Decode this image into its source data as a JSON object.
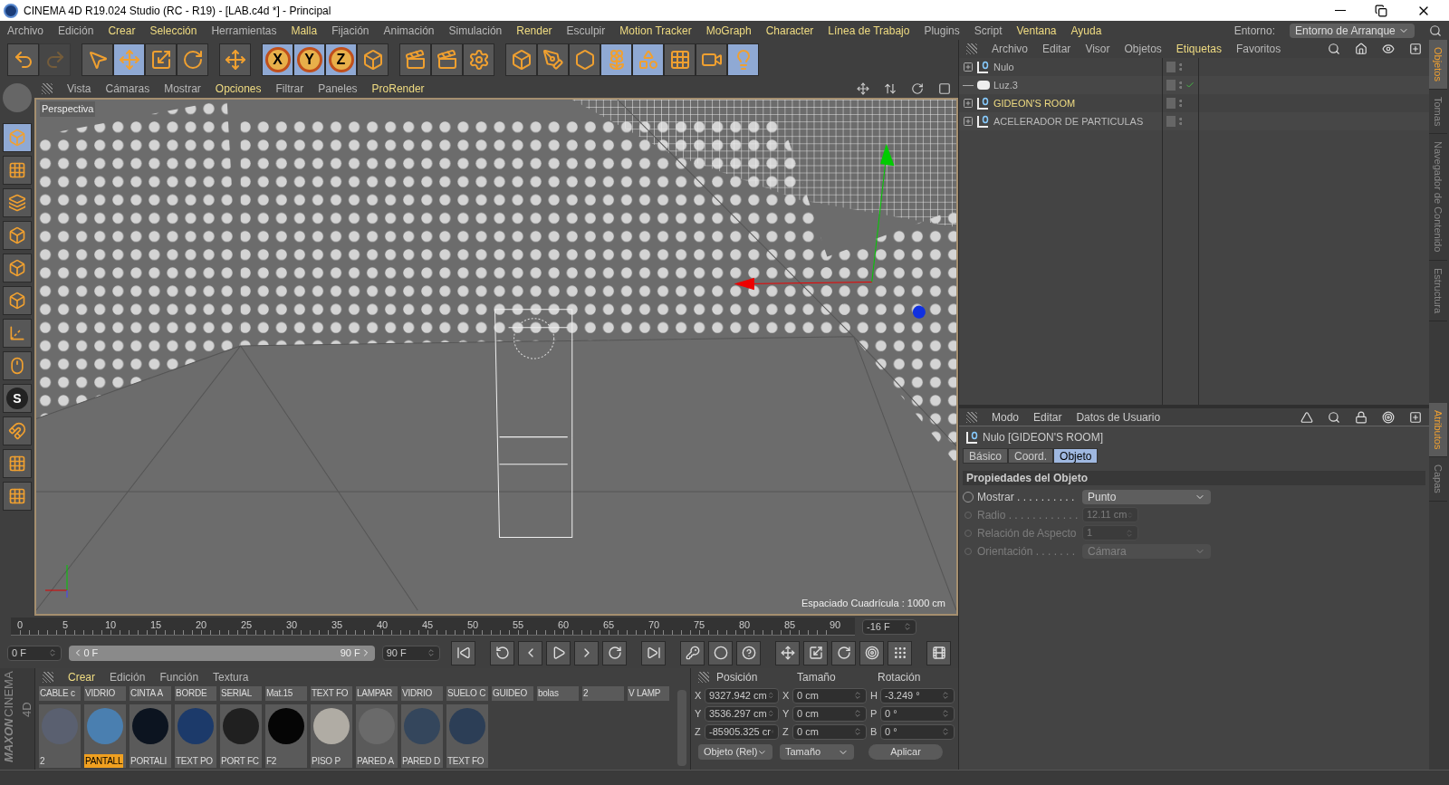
{
  "window": {
    "title": "CINEMA 4D R19.024 Studio (RC - R19) - [LAB.c4d *] - Principal"
  },
  "menu": [
    {
      "label": "Archivo",
      "highlighted": false
    },
    {
      "label": "Edición",
      "highlighted": false
    },
    {
      "label": "Crear",
      "highlighted": true
    },
    {
      "label": "Selección",
      "highlighted": true
    },
    {
      "label": "Herramientas",
      "highlighted": false
    },
    {
      "label": "Malla",
      "highlighted": true
    },
    {
      "label": "Fijación",
      "highlighted": false
    },
    {
      "label": "Animación",
      "highlighted": false
    },
    {
      "label": "Simulación",
      "highlighted": false
    },
    {
      "label": "Render",
      "highlighted": true
    },
    {
      "label": "Esculpir",
      "highlighted": false
    },
    {
      "label": "Motion Tracker",
      "highlighted": true
    },
    {
      "label": "MoGraph",
      "highlighted": true
    },
    {
      "label": "Character",
      "highlighted": true
    },
    {
      "label": "Línea de Trabajo",
      "highlighted": true
    },
    {
      "label": "Plugins",
      "highlighted": false
    },
    {
      "label": "Script",
      "highlighted": false
    },
    {
      "label": "Ventana",
      "highlighted": true
    },
    {
      "label": "Ayuda",
      "highlighted": true
    }
  ],
  "layout": {
    "label": "Entorno:",
    "value": "Entorno de Arranque"
  },
  "toolbar": [
    {
      "selected": false,
      "disabled": false
    },
    {
      "selected": false,
      "disabled": true
    },
    {
      "selected": false,
      "disabled": false
    },
    {
      "selected": true,
      "disabled": false
    },
    {
      "selected": false,
      "disabled": false
    },
    {
      "selected": false,
      "disabled": false
    },
    {
      "selected": false,
      "disabled": false
    },
    {
      "label": "X",
      "selected": true,
      "disabled": false
    },
    {
      "label": "Y",
      "selected": true,
      "disabled": false
    },
    {
      "label": "Z",
      "selected": true,
      "disabled": false
    },
    {
      "selected": false,
      "disabled": false
    },
    {
      "selected": false,
      "disabled": false
    },
    {
      "selected": false,
      "disabled": false
    },
    {
      "selected": false,
      "disabled": false
    },
    {
      "selected": false,
      "disabled": false
    },
    {
      "selected": false,
      "disabled": false
    },
    {
      "selected": false,
      "disabled": false
    },
    {
      "selected": true,
      "disabled": false
    },
    {
      "selected": true,
      "disabled": false
    },
    {
      "selected": false,
      "disabled": false
    },
    {
      "selected": false,
      "disabled": false
    },
    {
      "selected": true,
      "disabled": false
    }
  ],
  "left_tools": [
    {
      "selected": true
    },
    {
      "selected": false
    },
    {
      "selected": false
    },
    {
      "selected": false
    },
    {
      "selected": false
    },
    {
      "selected": false
    },
    {
      "selected": false
    },
    {
      "selected": false
    },
    {
      "label": "S",
      "selected": false
    },
    {
      "selected": false
    },
    {
      "selected": false
    },
    {
      "selected": false
    }
  ],
  "viewport": {
    "menu": [
      {
        "label": "Vista",
        "highlighted": false
      },
      {
        "label": "Cámaras",
        "highlighted": false
      },
      {
        "label": "Mostrar",
        "highlighted": false
      },
      {
        "label": "Opciones",
        "highlighted": true
      },
      {
        "label": "Filtrar",
        "highlighted": false
      },
      {
        "label": "Paneles",
        "highlighted": false
      },
      {
        "label": "ProRender",
        "highlighted": true
      }
    ],
    "camera": "Perspectiva",
    "grid_spacing": "Espaciado Cuadrícula : 1000 cm"
  },
  "timeline": {
    "ticks": [
      "0",
      "5",
      "10",
      "15",
      "20",
      "25",
      "30",
      "35",
      "40",
      "45",
      "50",
      "55",
      "60",
      "65",
      "70",
      "75",
      "80",
      "85",
      "90"
    ],
    "current_frame": "-16 F",
    "start": "0 F",
    "range_slider": {
      "level": 1
    },
    "range_start": "0 F",
    "range_end": "90 F",
    "end": "90 F"
  },
  "materials": {
    "menu": [
      {
        "label": "Crear",
        "highlighted": true
      },
      {
        "label": "Edición",
        "highlighted": false
      },
      {
        "label": "Función",
        "highlighted": false
      },
      {
        "label": "Textura",
        "highlighted": false
      }
    ],
    "top_row": [
      "CABLE c",
      "VIDRIO",
      "CINTA A",
      "BORDE",
      "SERIAL",
      "Mat.15",
      "TEXT FO",
      "LAMPAR",
      "VIDRIO",
      "SUELO C",
      "GUIDEO",
      "bolas",
      "2",
      "V LAMP"
    ],
    "items": [
      {
        "name": "2",
        "color": "#5a6070",
        "selected": false
      },
      {
        "name": "PANTALL",
        "color": "#4a7fb0",
        "selected": true
      },
      {
        "name": "PORTALI",
        "color": "#0c1420",
        "selected": false
      },
      {
        "name": "TEXT PO",
        "color": "#1c3a6a",
        "selected": false
      },
      {
        "name": "PORT FC",
        "color": "#202020",
        "selected": false
      },
      {
        "name": "F2",
        "color": "#050505",
        "selected": false
      },
      {
        "name": "PISO P",
        "color": "#b0aca4",
        "selected": false
      },
      {
        "name": "PARED A",
        "color": "#6a6a6a",
        "selected": false
      },
      {
        "name": "PARED D",
        "color": "#34465c",
        "selected": false
      },
      {
        "name": "TEXT FO",
        "color": "#2c3e56",
        "selected": false
      }
    ]
  },
  "logo": [
    "MAXON",
    "CINEMA 4D"
  ],
  "coordinates": {
    "headers": [
      "Posición",
      "Tamaño",
      "Rotación"
    ],
    "rows": [
      {
        "cells": [
          {
            "axis": "X",
            "value": "9327.942 cm"
          },
          {
            "axis": "X",
            "value": "0 cm"
          },
          {
            "axis": "H",
            "value": "-3.249 °"
          }
        ]
      },
      {
        "cells": [
          {
            "axis": "Y",
            "value": "3536.297 cm"
          },
          {
            "axis": "Y",
            "value": "0 cm"
          },
          {
            "axis": "P",
            "value": "0 °"
          }
        ]
      },
      {
        "cells": [
          {
            "axis": "Z",
            "value": "-85905.325 cr"
          },
          {
            "axis": "Z",
            "value": "0 cm"
          },
          {
            "axis": "B",
            "value": "0 °"
          }
        ]
      }
    ],
    "dropdowns": [
      "Objeto (Rel)",
      "Tamaño"
    ],
    "apply": "Aplicar"
  },
  "objects": {
    "menu": [
      {
        "label": "Archivo",
        "highlighted": false
      },
      {
        "label": "Editar",
        "highlighted": false
      },
      {
        "label": "Visor",
        "highlighted": false
      },
      {
        "label": "Objetos",
        "highlighted": false
      },
      {
        "label": "Etiquetas",
        "highlighted": true
      },
      {
        "label": "Favoritos",
        "highlighted": false
      }
    ],
    "items": [
      {
        "name": "Nulo",
        "kind": "null",
        "expandable": true,
        "selected": false,
        "checked": false
      },
      {
        "name": "Luz.3",
        "kind": "light",
        "expandable": false,
        "selected": false,
        "checked": true
      },
      {
        "name": "GIDEON'S ROOM",
        "kind": "null",
        "expandable": true,
        "selected": true,
        "checked": false
      },
      {
        "name": "ACELERADOR DE PARTICULAS",
        "kind": "null",
        "expandable": true,
        "selected": false,
        "checked": false
      }
    ]
  },
  "side_tabs_top": [
    {
      "label": "Objetos",
      "selected": true
    },
    {
      "label": "Tomas",
      "selected": false
    },
    {
      "label": "Navegador de Contenido",
      "selected": false
    },
    {
      "label": "Estructura",
      "selected": false
    }
  ],
  "attributes": {
    "menu": [
      "Modo",
      "Editar",
      "Datos de Usuario"
    ],
    "title": "Nulo [GIDEON'S ROOM]",
    "tabs": [
      {
        "label": "Básico",
        "selected": false
      },
      {
        "label": "Coord.",
        "selected": false
      },
      {
        "label": "Objeto",
        "selected": true
      }
    ],
    "section": "Propiedades del Objeto",
    "properties": [
      {
        "label": "Mostrar . . . . . . . . . .",
        "value": "Punto",
        "kind": "dropdown",
        "disabled": false
      },
      {
        "label": "Radio . . . . . . . . . . . .",
        "value": "12.11 cm",
        "kind": "number",
        "disabled": true
      },
      {
        "label": "Relación de Aspecto",
        "value": "1",
        "kind": "number",
        "disabled": true
      },
      {
        "label": "Orientación . . . . . . .",
        "value": "Cámara",
        "kind": "dropdown",
        "disabled": true
      }
    ]
  },
  "side_tabs_bottom": [
    {
      "label": "Atributos",
      "selected": true
    },
    {
      "label": "Capas",
      "selected": false
    }
  ]
}
